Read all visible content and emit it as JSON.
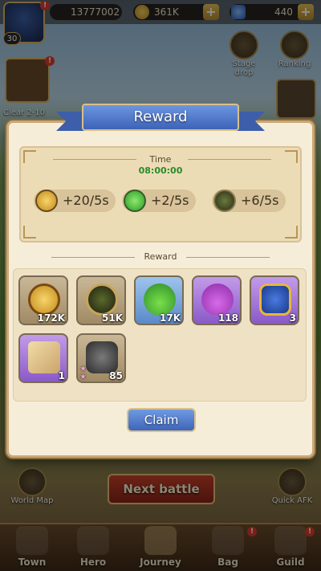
{
  "topbar": {
    "level": "30",
    "power": "13777002",
    "gold": "361K",
    "gems": "440",
    "plus": "+",
    "badge": "!"
  },
  "side": {
    "stage_drop": "Stage drop",
    "ranking": "Ranking",
    "clear": "Clear 2-10"
  },
  "dialog": {
    "title": "Reward",
    "time_label": "Time",
    "time_value": "08:00:00",
    "rates": [
      {
        "icon": "gold-coin-icon",
        "text": "+20/5s"
      },
      {
        "icon": "green-potion-icon",
        "text": "+2/5s"
      },
      {
        "icon": "exp-icon",
        "text": "+6/5s"
      }
    ],
    "reward_label": "Reward",
    "items": [
      {
        "icon": "gold-coin-icon",
        "count": "172K"
      },
      {
        "icon": "exp-orb-icon",
        "count": "51K"
      },
      {
        "icon": "green-potion-icon",
        "count": "17K"
      },
      {
        "icon": "purple-potion-icon",
        "count": "118"
      },
      {
        "icon": "lightning-shield-icon",
        "count": "3"
      },
      {
        "icon": "scroll-map-icon",
        "count": "1"
      },
      {
        "icon": "armor-icon",
        "count": "85"
      }
    ],
    "claim": "Claim"
  },
  "bottom": {
    "world_map": "World Map",
    "next_battle": "Next battle",
    "quick_afk": "Quick AFK",
    "nav": [
      "Town",
      "Hero",
      "Journey",
      "Bag",
      "Guild"
    ]
  },
  "colors": {
    "gold": "#e9b63a",
    "green": "#2a8a2a",
    "blue_button": "#3e65b8"
  }
}
